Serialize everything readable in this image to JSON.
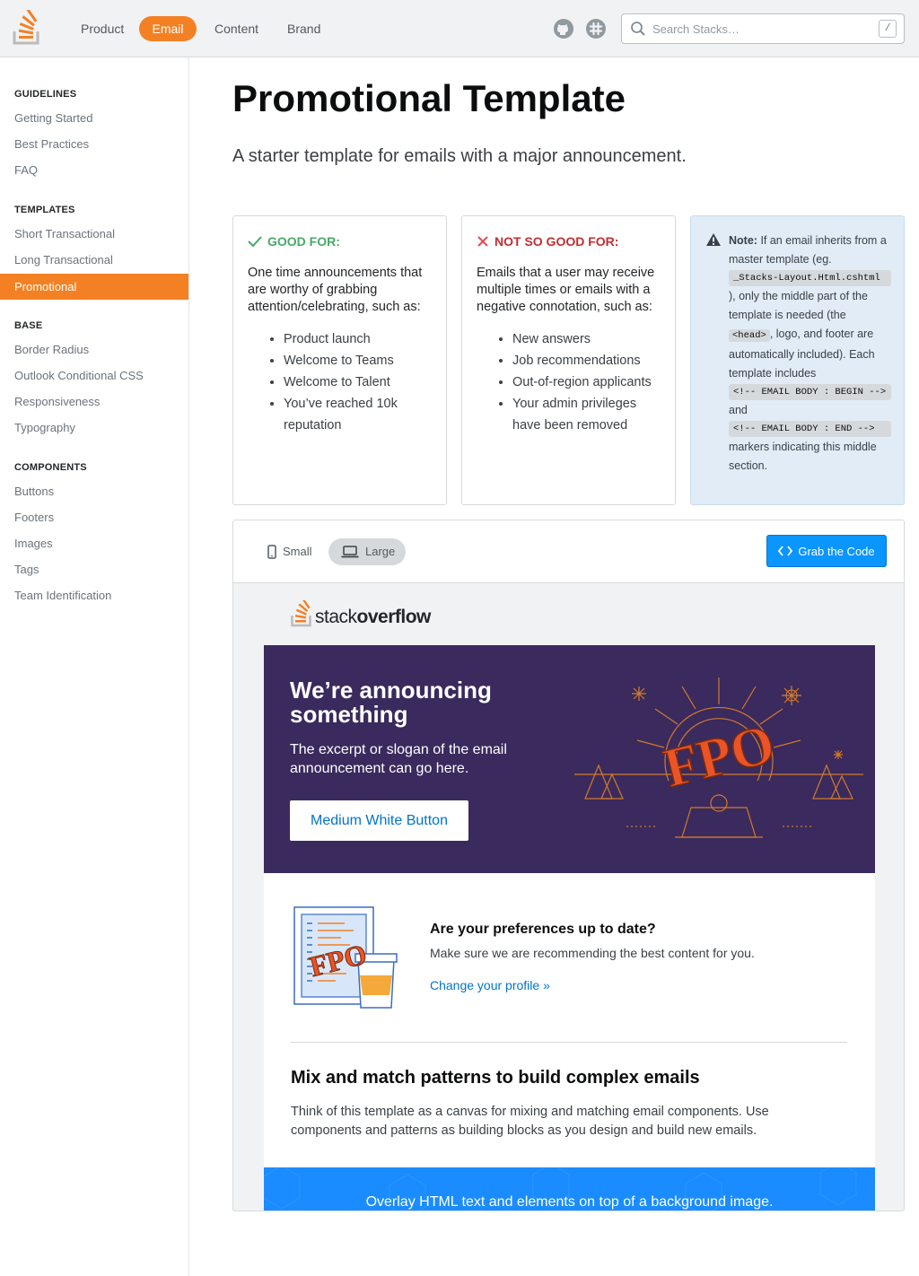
{
  "topnav": {
    "items": [
      {
        "label": "Product"
      },
      {
        "label": "Email",
        "active": true
      },
      {
        "label": "Content"
      },
      {
        "label": "Brand"
      }
    ],
    "icons": [
      "github-icon",
      "slack-icon"
    ],
    "search": {
      "placeholder": "Search Stacks…",
      "shortcut": "/"
    }
  },
  "sidebar": {
    "sections": [
      {
        "heading": "GUIDELINES",
        "items": [
          "Getting Started",
          "Best Practices",
          "FAQ"
        ]
      },
      {
        "heading": "TEMPLATES",
        "items": [
          "Short Transactional",
          "Long Transactional",
          "Promotional"
        ]
      },
      {
        "heading": "BASE",
        "items": [
          "Border Radius",
          "Outlook Conditional CSS",
          "Responsiveness",
          "Typography"
        ]
      },
      {
        "heading": "COMPONENTS",
        "items": [
          "Buttons",
          "Footers",
          "Images",
          "Tags",
          "Team Identification"
        ]
      }
    ],
    "active_item": "Promotional"
  },
  "page": {
    "title": "Promotional Template",
    "description": "A starter template for emails with a major announcement."
  },
  "good_card": {
    "heading": "GOOD FOR:",
    "text": "One time announcements that are worthy of grabbing attention/celebrating, such as:",
    "items": [
      "Product launch",
      "Welcome to Teams",
      "Welcome to Talent",
      "You’ve reached 10k reputation"
    ]
  },
  "bad_card": {
    "heading": "NOT SO GOOD FOR:",
    "text": "Emails that a user may receive multiple times or emails with a negative connotation, such as:",
    "items": [
      "New answers",
      "Job recommendations",
      "Out-of-region applicants",
      "Your admin privileges have been removed"
    ]
  },
  "note_card": {
    "label": "Note:",
    "text1": "If an email inherits from a master template (eg.",
    "code1": "_Stacks-Layout.Html.cshtml",
    "text2": "), only the middle part of the template is needed (the",
    "code2": "<head>",
    "text3": ", logo, and footer are automatically included). Each template includes",
    "code3": "<!-- EMAIL BODY : BEGIN -->",
    "text4": "and",
    "code4": "<!-- EMAIL BODY : END -->",
    "text5": "markers indicating this middle section."
  },
  "preview": {
    "toggles": [
      {
        "label": "Small",
        "icon": "phone-icon"
      },
      {
        "label": "Large",
        "icon": "laptop-icon",
        "active": true
      }
    ],
    "grab_button": "Grab the Code",
    "logo": {
      "light": "stack",
      "bold": "overflow"
    },
    "hero": {
      "title": "We’re announcing something",
      "text": "The excerpt or slogan of the email announcement can go here.",
      "button": "Medium White Button",
      "art_stamp": "FPO"
    },
    "preferences": {
      "title": "Are your preferences up to date?",
      "text": "Make sure we are recommending the best content for you.",
      "link": "Change your profile »",
      "art_stamp": "FPO"
    },
    "mix": {
      "title": "Mix and match patterns to build complex emails",
      "text": "Think of this template as a canvas for mixing and matching email components. Use components and patterns as building blocks as you design and build new emails."
    },
    "overlay": {
      "text": "Overlay HTML text and elements on top of a background image."
    }
  },
  "colors": {
    "brand_orange": "#f48024",
    "accent_blue": "#0a95ff",
    "hero_purple": "#3a2a5d",
    "good_green": "#48a868",
    "bad_red": "#de4f54",
    "note_bg": "#e1ecf7"
  }
}
